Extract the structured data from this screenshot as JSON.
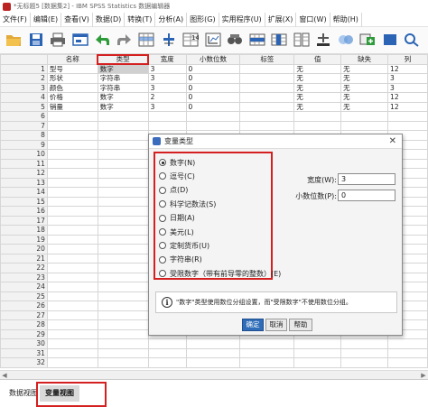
{
  "window": {
    "title": "*无标题5 [数据集2] - IBM SPSS Statistics 数据编辑器"
  },
  "menu": [
    "文件(F)",
    "编辑(E)",
    "查看(V)",
    "数据(D)",
    "转换(T)",
    "分析(A)",
    "图形(G)",
    "实用程序(U)",
    "扩展(X)",
    "窗口(W)",
    "帮助(H)"
  ],
  "toolbar": [
    "open-icon",
    "save-icon",
    "print-icon",
    "dialog-recall-icon",
    "undo-icon",
    "redo-icon",
    "goto-case-icon",
    "goto-variable-icon",
    "variables-icon",
    "run-descriptives-icon",
    "find-icon",
    "insert-cases-icon",
    "insert-variable-icon",
    "split-file-icon",
    "weight-cases-icon",
    "select-cases-icon",
    "value-labels-icon",
    "use-variable-sets-icon",
    "search-icon"
  ],
  "grid": {
    "headers": [
      "",
      "名称",
      "类型",
      "宽度",
      "小数位数",
      "标签",
      "值",
      "缺失",
      "列"
    ],
    "rows": [
      [
        "1",
        "型号",
        "数字",
        "3",
        "0",
        "",
        "无",
        "无",
        "12"
      ],
      [
        "2",
        "形状",
        "字符串",
        "3",
        "0",
        "",
        "无",
        "无",
        "3"
      ],
      [
        "3",
        "颜色",
        "字符串",
        "3",
        "0",
        "",
        "无",
        "无",
        "3"
      ],
      [
        "4",
        "价格",
        "数字",
        "2",
        "0",
        "",
        "无",
        "无",
        "12"
      ],
      [
        "5",
        "销量",
        "数字",
        "3",
        "0",
        "",
        "无",
        "无",
        "12"
      ],
      [
        "6"
      ],
      [
        "7"
      ],
      [
        "8"
      ],
      [
        "9"
      ],
      [
        "10"
      ],
      [
        "11"
      ],
      [
        "12"
      ],
      [
        "13"
      ],
      [
        "14"
      ],
      [
        "15"
      ],
      [
        "16"
      ],
      [
        "17"
      ],
      [
        "18"
      ],
      [
        "19"
      ],
      [
        "20"
      ],
      [
        "21"
      ],
      [
        "22"
      ],
      [
        "23"
      ],
      [
        "24"
      ],
      [
        "25"
      ],
      [
        "26"
      ],
      [
        "27"
      ],
      [
        "28"
      ],
      [
        "29"
      ],
      [
        "30"
      ],
      [
        "31"
      ],
      [
        "32"
      ]
    ]
  },
  "tabs": {
    "data_view": "数据视图",
    "variable_view": "变量视图"
  },
  "dialog": {
    "title": "变量类型",
    "options": [
      "数字(N)",
      "逗号(C)",
      "点(D)",
      "科学记数法(S)",
      "日期(A)",
      "美元(L)",
      "定制货币(U)",
      "字符串(R)",
      "受限数字（带有前导零的整数）(E)"
    ],
    "selected": "数字(N)",
    "width_label": "宽度(W):",
    "width_value": "3",
    "decimals_label": "小数位数(P):",
    "decimals_value": "0",
    "info": "\"数字\"类型使用数位分组设置，而\"受限数字\"不使用数位分组。",
    "ok": "确定",
    "cancel": "取消",
    "help": "帮助"
  }
}
